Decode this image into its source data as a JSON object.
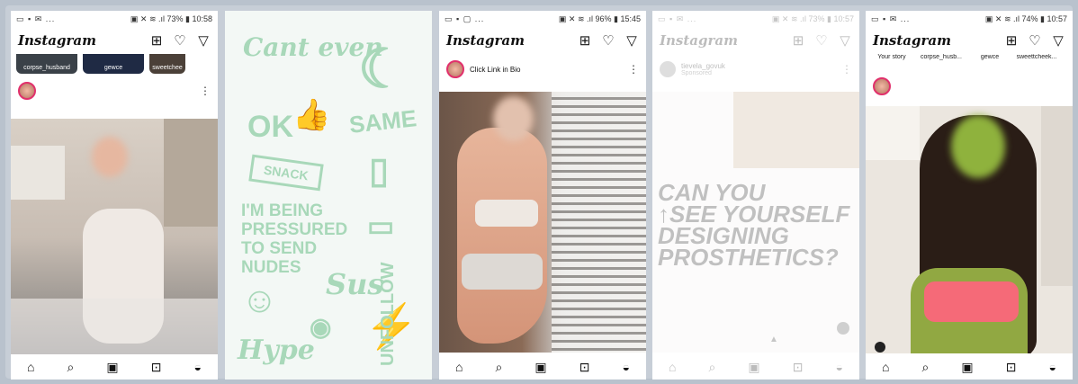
{
  "panels": [
    {
      "status": {
        "left": "▭ ▪ ✉ ...",
        "right": "▣ ✕ ≋ .ıl 73% ▮ 10:58"
      },
      "app_title": "Instagram",
      "stories": [
        "corpse_husband",
        "gewce",
        "sweetchee"
      ],
      "nav_icons": [
        "home-icon",
        "search-icon",
        "reels-icon",
        "shop-icon",
        "profile-icon"
      ]
    },
    {
      "stickers": [
        "Cant even",
        "OK",
        "SAME",
        "SNACK",
        "I'M BEING PRESSURED TO SEND NUDES",
        "Sus",
        "Hype",
        "UNFOLLOW"
      ]
    },
    {
      "status": {
        "left": "▭ ▪ ▢ ...",
        "right": "▣ ✕ ≋ .ıl 96% ▮ 15:45"
      },
      "app_title": "Instagram",
      "post_caption": "Click Link in Bio"
    },
    {
      "status": {
        "left": "▭ ▪ ✉ ...",
        "right": "▣ ✕ ≋ .ıl 73% ▮ 10:57"
      },
      "app_title": "Instagram",
      "account": "tievela_govuk",
      "sponsored": "Sponsored",
      "ad_text": [
        "CAN YOU",
        "↑SEE YOURSELF",
        "DESIGNING",
        "PROSTHETICS?"
      ]
    },
    {
      "status": {
        "left": "▭ ▪ ✉ ...",
        "right": "▣ ✕ ≋ .ıl 74% ▮ 10:57"
      },
      "app_title": "Instagram",
      "stories": [
        "Your story",
        "corpse_husb...",
        "gewce",
        "sweettcheek..."
      ]
    }
  ]
}
